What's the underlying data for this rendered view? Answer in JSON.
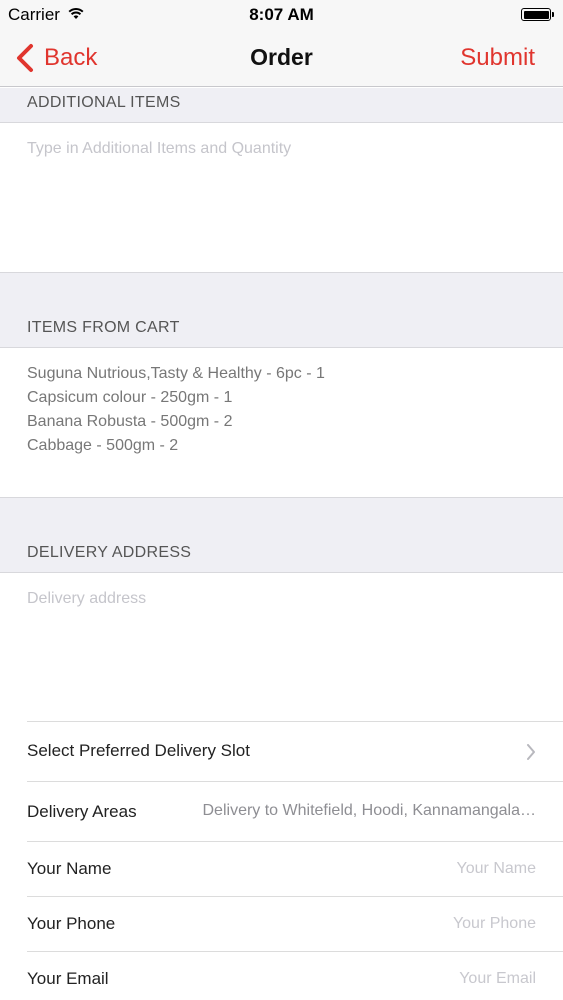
{
  "status_bar": {
    "carrier": "Carrier",
    "time": "8:07 AM",
    "icons": [
      "wifi-icon",
      "battery-icon"
    ]
  },
  "nav": {
    "back_label": "Back",
    "title": "Order",
    "submit_label": "Submit",
    "accent_color": "#e0352e"
  },
  "additional_items": {
    "header": "ADDITIONAL ITEMS",
    "placeholder": "Type in Additional Items and Quantity"
  },
  "cart": {
    "header": "ITEMS FROM CART",
    "items": [
      "Suguna Nutrious,Tasty & Healthy - 6pc - 1",
      "Capsicum colour - 250gm - 1",
      "Banana Robusta - 500gm - 2",
      "Cabbage - 500gm - 2"
    ]
  },
  "delivery": {
    "header": "DELIVERY ADDRESS",
    "placeholder": "Delivery address"
  },
  "rows": {
    "slot_label": "Select Preferred Delivery Slot",
    "areas_label": "Delivery Areas",
    "areas_value": "Delivery to Whitefield, Hoodi, Kannamangala…",
    "name_label": "Your Name",
    "name_placeholder": "Your Name",
    "phone_label": "Your Phone",
    "phone_placeholder": "Your Phone",
    "email_label": "Your Email",
    "email_placeholder": "Your Email"
  }
}
